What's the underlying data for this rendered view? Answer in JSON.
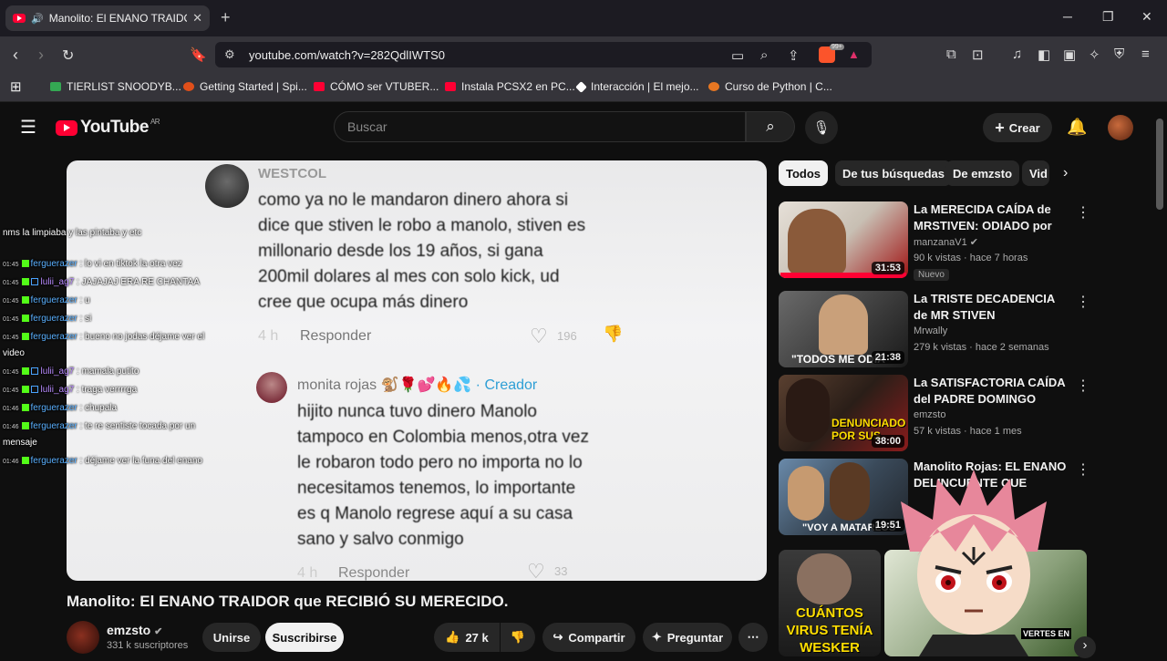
{
  "browser": {
    "tab_title": "Manolito: El ENANO TRAIDOR",
    "url": "youtube.com/watch?v=282QdlIWTS0",
    "badge_count": "99+",
    "bookmarks": [
      {
        "label": "TIERLIST SNOODYB...",
        "color": "#34a853"
      },
      {
        "label": "Getting Started | Spi...",
        "color": "#e04f1a"
      },
      {
        "label": "CÓMO ser VTUBER...",
        "color": "#ff0033"
      },
      {
        "label": "Instala PCSX2 en PC...",
        "color": "#ff0033"
      },
      {
        "label": "Interacción | El mejo...",
        "color": "#ffffff"
      },
      {
        "label": "Curso de Python | C...",
        "color": "#e87722"
      }
    ]
  },
  "youtube": {
    "logo_text": "YouTube",
    "region": "AR",
    "search_placeholder": "Buscar",
    "create_label": "Crear"
  },
  "video_content": {
    "comment1_author": "WESTCOL",
    "comment1_lines": [
      "como ya no le mandaron dinero ahora si",
      "dice que stiven le robo a manolo, stiven es",
      "millonario desde los 19 años, si gana",
      "200mil dolares al mes con solo kick, ud",
      "cree que ocupa más dinero"
    ],
    "comment1_time": "4 h",
    "reply_label": "Responder",
    "comment1_likes": "196",
    "comment2_author": "monita rojas",
    "comment2_emojis": "🐒🌹💕🔥💦",
    "comment2_creator": "· Creador",
    "comment2_lines": [
      "hijito nunca tuvo dinero Manolo",
      "tampoco en Colombia menos,otra vez",
      "le robaron todo pero no importa no lo",
      "necesitamos tenemos, lo importante",
      "es q Manolo regrese aquí a su casa",
      "sano y salvo conmigo"
    ],
    "comment2_time": "4 h",
    "comment2_likes": "33"
  },
  "chat": [
    {
      "time": "",
      "user": "ferguerazer",
      "text": "nms la limpiaba y las pintaba y etc",
      "cls": "u1"
    },
    {
      "time": "01:45",
      "user": "ferguerazer",
      "text": ": lo vi en tiktok la otra vez",
      "cls": "u1"
    },
    {
      "time": "01:45",
      "user": "lulii_ag7",
      "text": ": JAJAJAJ ERA RE CHANTAA",
      "cls": "u2"
    },
    {
      "time": "01:45",
      "user": "ferguerazer",
      "text": ": u",
      "cls": "u1"
    },
    {
      "time": "01:45",
      "user": "ferguerazer",
      "text": ": si",
      "cls": "u1"
    },
    {
      "time": "01:45",
      "user": "ferguerazer",
      "text": ": bueno no jodas déjame ver el",
      "cls": "u1"
    },
    {
      "time": "",
      "user": "",
      "text": "video",
      "cls": ""
    },
    {
      "time": "01:45",
      "user": "lulii_ag7",
      "text": ": mamala putito",
      "cls": "u2"
    },
    {
      "time": "01:45",
      "user": "lulii_ag7",
      "text": ": traga verrrrga",
      "cls": "u2"
    },
    {
      "time": "01:46",
      "user": "ferguerazer",
      "text": ": chupala",
      "cls": "u1"
    },
    {
      "time": "01:46",
      "user": "ferguerazer",
      "text": ": te re sentiste tocada por un",
      "cls": "u1"
    },
    {
      "time": "",
      "user": "",
      "text": "mensaje",
      "cls": ""
    },
    {
      "time": "01:46",
      "user": "ferguerazer",
      "text": ": déjame ver la funa del enano",
      "cls": "u1"
    }
  ],
  "video": {
    "title": "Manolito: El ENANO TRAIDOR que RECIBIÓ SU MERECIDO.",
    "channel": "emzsto",
    "subscribers": "331 k suscriptores",
    "join_label": "Unirse",
    "subscribe_label": "Suscribirse",
    "likes": "27 k",
    "share_label": "Compartir",
    "ask_label": "Preguntar"
  },
  "chips": [
    "Todos",
    "De tus búsquedas",
    "De emzsto",
    "Vid"
  ],
  "recommendations": [
    {
      "title": "La MERECIDA CAÍDA de MRSTIVEN: ODIADO por SUS ...",
      "channel": "manzanaV1",
      "verified": true,
      "meta": "90 k vistas · hace 7 horas",
      "duration": "31:53",
      "badge": "Nuevo",
      "thumb_text": "",
      "colors": [
        "#d6d0c8",
        "#7a1010"
      ]
    },
    {
      "title": "La TRISTE DECADENCIA de MR STIVEN",
      "channel": "Mrwally",
      "verified": false,
      "meta": "279 k vistas · hace 2 semanas",
      "duration": "21:38",
      "badge": "",
      "thumb_text": "\"TODOS ME ODIA",
      "colors": [
        "#5a5a5a",
        "#1a1a1a"
      ]
    },
    {
      "title": "La SATISFACTORIA CAÍDA del PADRE DOMINGO",
      "channel": "emzsto",
      "verified": false,
      "meta": "57 k vistas · hace 1 mes",
      "duration": "38:00",
      "badge": "",
      "thumb_text": "DENUNCIADO POR SUS",
      "colors": [
        "#3a2a22",
        "#8a1c1c"
      ]
    },
    {
      "title": "Manolito Rojas: EL ENANO DELINCUENTE QUE RECIBIÓ su...",
      "channel": "",
      "verified": false,
      "meta": "",
      "duration": "19:51",
      "badge": "",
      "thumb_text": "\"VOY A MATARLOS",
      "colors": [
        "#4a6a8a",
        "#20242a"
      ]
    }
  ],
  "bottom_thumbs": [
    {
      "text": "CUÁNTOS VIRUS TENÍA WESKER",
      "colors": [
        "#3a3a3a",
        "#1a1a1a"
      ]
    },
    {
      "text": "VERTES EN",
      "colors": [
        "#cfd8c0",
        "#3a5a2a"
      ]
    }
  ]
}
